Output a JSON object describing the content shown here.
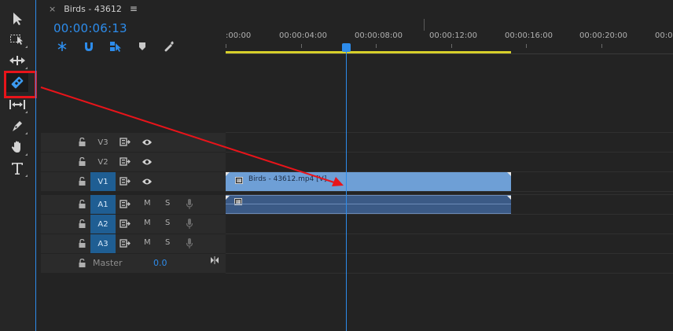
{
  "tab": {
    "close_symbol": "×",
    "title": "Birds - 43612",
    "menu_symbol": "≡"
  },
  "timecode": "00:00:06:13",
  "ruler": {
    "labels": [
      ":00:00",
      "00:00:04:00",
      "00:00:08:00",
      "00:00:12:00",
      "00:00:16:00",
      "00:00:20:00",
      "00:00"
    ]
  },
  "tools": [
    "selection-tool",
    "track-select-forward-tool",
    "ripple-edit-tool",
    "razor-tool",
    "slip-tool",
    "pen-tool",
    "hand-tool",
    "type-tool"
  ],
  "timeline_controls": [
    "nest-snap-icon",
    "snap-magnet-icon",
    "linked-selection-icon",
    "add-marker-icon",
    "wrench-icon"
  ],
  "tracks": {
    "video": [
      {
        "name": "V3",
        "target": false
      },
      {
        "name": "V2",
        "target": false
      },
      {
        "name": "V1",
        "target": true
      }
    ],
    "audio": [
      {
        "name": "A1",
        "target": true,
        "mute": "M",
        "solo": "S"
      },
      {
        "name": "A2",
        "target": true,
        "mute": "M",
        "solo": "S"
      },
      {
        "name": "A3",
        "target": true,
        "mute": "M",
        "solo": "S"
      }
    ],
    "master": {
      "label": "Master",
      "value": "0.0"
    }
  },
  "clips": {
    "video_label": "Birds - 43612.mp4 [V]"
  },
  "colors": {
    "accent": "#2d8ceb",
    "video_clip": "#6e9fd6",
    "audio_clip": "#3b5a86",
    "annotation": "#e8141a",
    "work_area": "#d6cf2a"
  }
}
